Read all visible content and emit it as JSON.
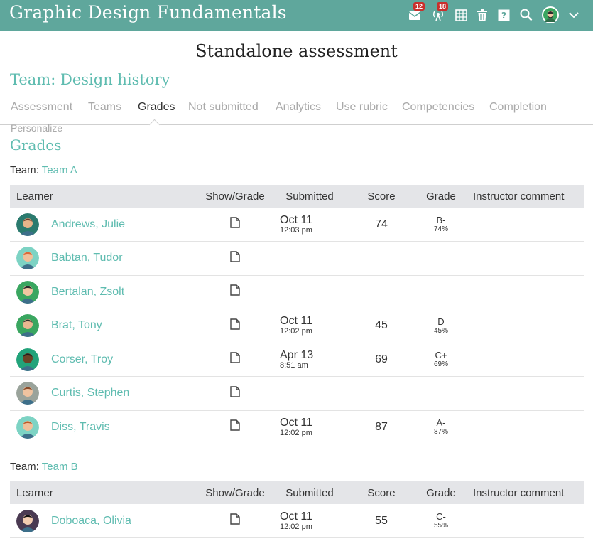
{
  "app": {
    "title": "Graphic Design Fundamentals"
  },
  "toolbar": {
    "mail_badge": "12",
    "notifications_badge": "18",
    "icons": [
      "mail-icon",
      "broadcast-icon",
      "calendar-icon",
      "trash-icon",
      "help-icon",
      "search-icon",
      "user-avatar",
      "chevron-down-icon"
    ]
  },
  "page": {
    "title": "Standalone assessment",
    "team_heading": "Team: Design history",
    "section_title": "Grades"
  },
  "tabs": [
    "Assessment",
    "Teams",
    "Grades",
    "Not submitted",
    "Analytics",
    "Use rubric",
    "Competencies",
    "Completion",
    "Personalize"
  ],
  "active_tab": "Grades",
  "table_headers": {
    "learner": "Learner",
    "show_grade": "Show/Grade",
    "submitted": "Submitted",
    "score": "Score",
    "grade": "Grade",
    "comment": "Instructor comment"
  },
  "teams": [
    {
      "prefix": "Team:",
      "name": "Team A",
      "learners": [
        {
          "name": "Andrews, Julie",
          "date": "Oct 11",
          "time": "12:03 pm",
          "score": "74",
          "grade": "B-",
          "percent": "74%",
          "avatar_bg": "#2b7a6e",
          "skin": "#e8b48a",
          "hair": "#6b3b2a"
        },
        {
          "name": "Babtan, Tudor",
          "date": "",
          "time": "",
          "score": "",
          "grade": "",
          "percent": "",
          "avatar_bg": "#7dd3c4",
          "skin": "#f0c09a",
          "hair": "#d86a3a"
        },
        {
          "name": "Bertalan, Zsolt",
          "date": "",
          "time": "",
          "score": "",
          "grade": "",
          "percent": "",
          "avatar_bg": "#3aa660",
          "skin": "#f1c6a2",
          "hair": "#2c2c2c"
        },
        {
          "name": "Brat, Tony",
          "date": "Oct 11",
          "time": "12:02 pm",
          "score": "45",
          "grade": "D",
          "percent": "45%",
          "avatar_bg": "#3aa660",
          "skin": "#e9b791",
          "hair": "#2c2c2c"
        },
        {
          "name": "Corser, Troy",
          "date": "Apr 13",
          "time": "8:51 am",
          "score": "69",
          "grade": "C+",
          "percent": "69%",
          "avatar_bg": "#22a37a",
          "skin": "#6b4326",
          "hair": "#1e1e1e"
        },
        {
          "name": "Curtis, Stephen",
          "date": "",
          "time": "",
          "score": "",
          "grade": "",
          "percent": "",
          "avatar_bg": "#9aa39b",
          "skin": "#efc3a0",
          "hair": "#8a4b2a"
        },
        {
          "name": "Diss, Travis",
          "date": "Oct 11",
          "time": "12:02 pm",
          "score": "87",
          "grade": "A-",
          "percent": "87%",
          "avatar_bg": "#7dd3c4",
          "skin": "#f0c09a",
          "hair": "#b85a2a"
        }
      ]
    },
    {
      "prefix": "Team:",
      "name": "Team B",
      "learners": [
        {
          "name": "Doboaca, Olivia",
          "date": "Oct 11",
          "time": "12:02 pm",
          "score": "55",
          "grade": "C-",
          "percent": "55%",
          "avatar_bg": "#4a3a52",
          "skin": "#f3ccb0",
          "hair": "#111111"
        }
      ]
    }
  ],
  "colors": {
    "topbar": "#5fa79c",
    "accent": "#5fbcb0",
    "badge": "#c9302c",
    "header_bg": "#e4e5e8"
  }
}
